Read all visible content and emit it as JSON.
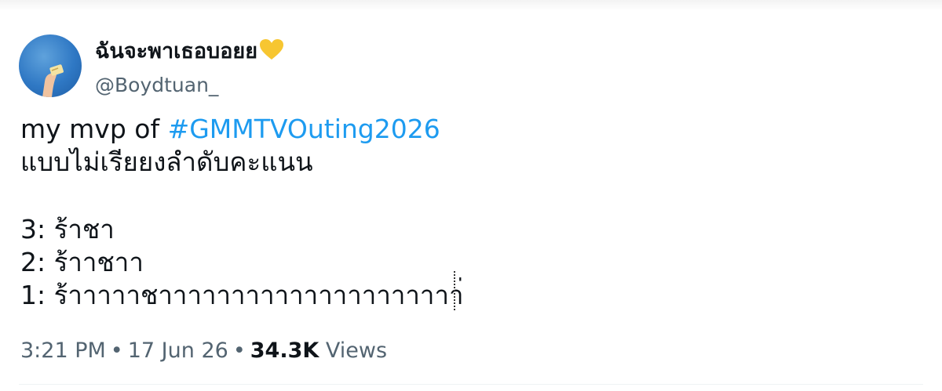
{
  "author": {
    "display_name": "ฉันจะพาเธอบอยย",
    "handle": "@Boydtuan_",
    "badge_icon": "yellow-heart-icon",
    "badge_color": "#f7c631"
  },
  "tweet": {
    "line1_prefix": "my mvp of ",
    "hashtag": "#GMMTVOuting2026",
    "line2": "แบบไม่เรียยงลำดับคะแนน",
    "rank3": "3: ร้าชา",
    "rank2": "2: ร้าาชาา",
    "rank1": "1:  ร้าาาาาชาาาาาาาาาาาาาาาาาาาาา่"
  },
  "meta": {
    "time": "3:21 PM",
    "date": "17 Jun 26",
    "views_count": "34.3K",
    "views_label": "Views",
    "separator": "•"
  },
  "colors": {
    "hashtag": "#1d9bf0",
    "secondary_text": "#536471",
    "primary_text": "#0f1419"
  }
}
